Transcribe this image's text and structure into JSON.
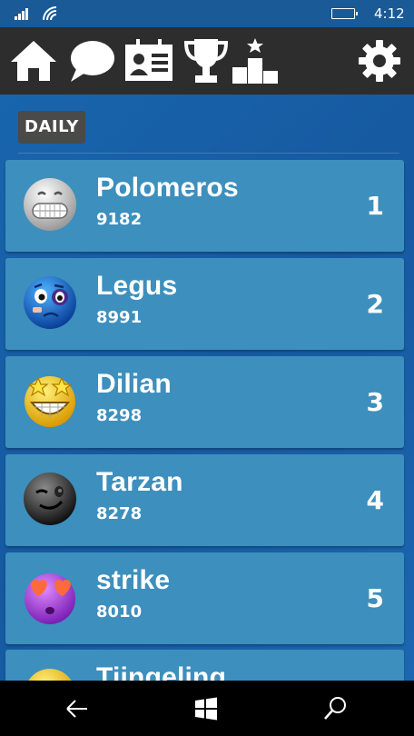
{
  "status_bar": {
    "time": "4:12"
  },
  "toolbar": {
    "icons": [
      "home-icon",
      "chat-icon",
      "profile-card-icon",
      "trophy-icon",
      "podium-icon",
      "gear-icon"
    ]
  },
  "section": {
    "tab_label": "DAILY"
  },
  "leaderboard": [
    {
      "name": "Polomeros",
      "score": "9182",
      "rank": "1",
      "avatar": "grinning-white-emoji"
    },
    {
      "name": "Legus",
      "score": "8991",
      "rank": "2",
      "avatar": "blue-bruised-emoji"
    },
    {
      "name": "Dilian",
      "score": "8298",
      "rank": "3",
      "avatar": "star-eyes-emoji"
    },
    {
      "name": "Tarzan",
      "score": "8278",
      "rank": "4",
      "avatar": "black-wink-emoji"
    },
    {
      "name": "strike",
      "score": "8010",
      "rank": "5",
      "avatar": "heart-eyes-purple-emoji"
    },
    {
      "name": "Tiingeling",
      "score": "",
      "rank": "",
      "avatar": "yellow-emoji"
    }
  ],
  "nav_bar": {
    "icons": [
      "back-icon",
      "windows-icon",
      "search-icon"
    ]
  },
  "colors": {
    "toolbar": "#2d2d2d",
    "background": "#1865ad",
    "row": "#3d8fbd",
    "tag": "#4a4a4a"
  }
}
